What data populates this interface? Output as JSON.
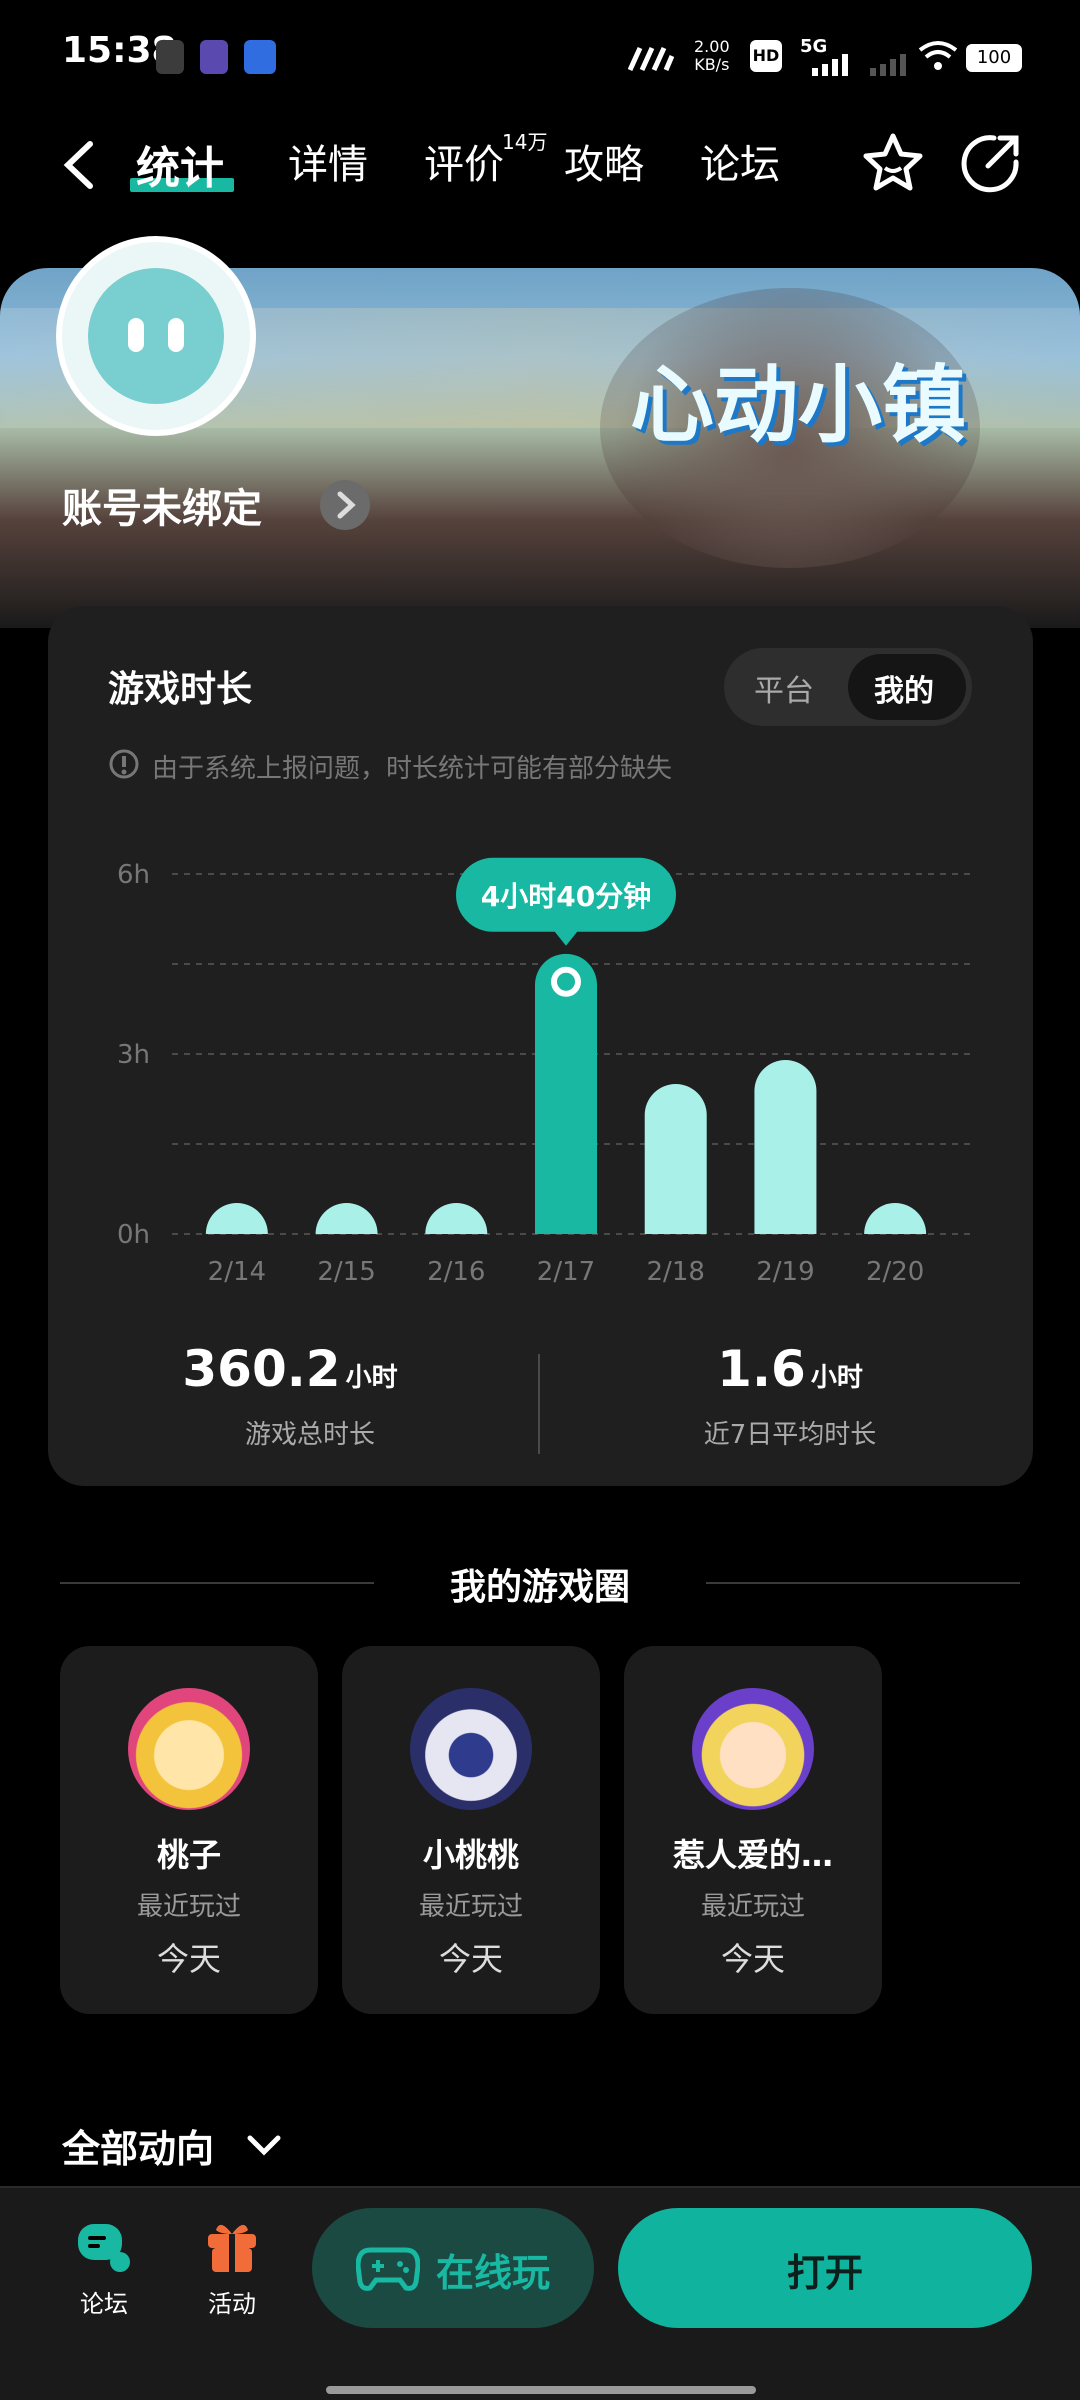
{
  "status_bar": {
    "time": "15:38",
    "net_speed_value": "2.00",
    "net_speed_unit": "KB/s",
    "hd_label": "HD",
    "signal_label": "5G",
    "battery": "100"
  },
  "nav": {
    "tabs": [
      {
        "label": "统计"
      },
      {
        "label": "详情"
      },
      {
        "label": "评价"
      },
      {
        "label": "攻略"
      },
      {
        "label": "论坛"
      }
    ],
    "review_count": "14万"
  },
  "banner": {
    "game_logo_text": "心动小镇",
    "account_status": "账号未绑定"
  },
  "playtime": {
    "title": "游戏时长",
    "toggle": {
      "option_platform": "平台",
      "option_mine": "我的"
    },
    "notice": "由于系统上报问题，时长统计可能有部分缺失",
    "tooltip": "4小时40分钟",
    "total_value": "360.2",
    "total_unit": "小时",
    "total_label": "游戏总时长",
    "avg_value": "1.6",
    "avg_unit": "小时",
    "avg_label": "近7日平均时长"
  },
  "chart_data": {
    "type": "bar",
    "categories": [
      "2/14",
      "2/15",
      "2/16",
      "2/17",
      "2/18",
      "2/19",
      "2/20"
    ],
    "values": [
      0.25,
      0.2,
      0.08,
      4.67,
      2.5,
      2.9,
      0.1
    ],
    "ylim": [
      0,
      6
    ],
    "yticks": [
      "0h",
      "3h",
      "6h"
    ],
    "highlight_index": 3,
    "colors": {
      "bar": "#a9f0e8",
      "highlight": "#18b8a2"
    }
  },
  "circle": {
    "title": "我的游戏圈",
    "items": [
      {
        "name": "桃子",
        "status": "最近玩过",
        "when": "今天"
      },
      {
        "name": "小桃桃",
        "status": "最近玩过",
        "when": "今天"
      },
      {
        "name": "惹人爱的…",
        "status": "最近玩过",
        "when": "今天"
      }
    ]
  },
  "activity": {
    "title": "全部动向"
  },
  "bottom": {
    "forum": "论坛",
    "events": "活动",
    "online_play": "在线玩",
    "open": "打开"
  },
  "colors": {
    "accent": "#18b8a2",
    "accent_dark": "#1b4a43"
  }
}
